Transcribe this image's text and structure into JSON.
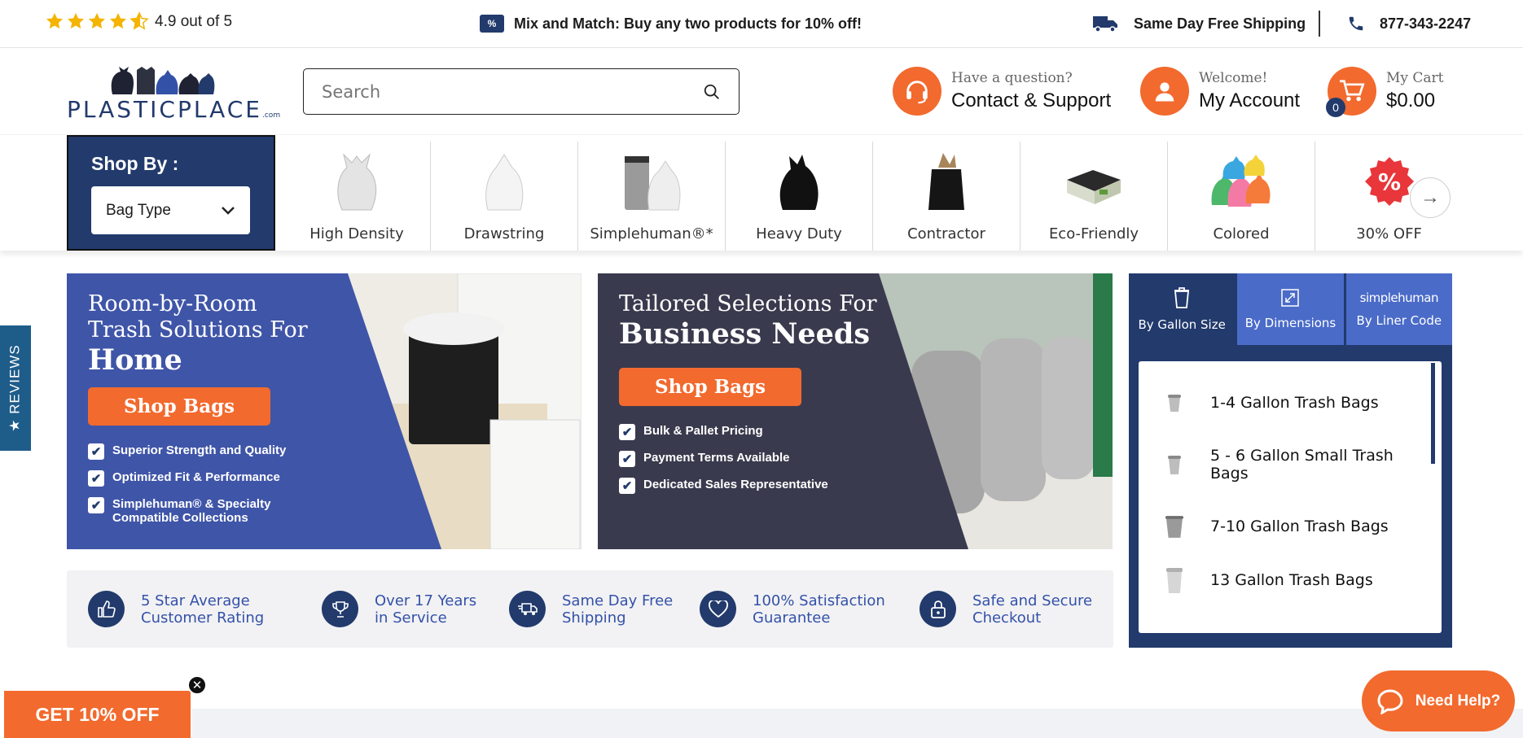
{
  "topbar": {
    "rating_text": "4.9 out of 5",
    "stars": 4.5,
    "promo_icon": "%",
    "promo_text": "Mix and Match: Buy any two products for 10% off!",
    "shipping_text": "Same Day Free Shipping",
    "phone": "877-343-2247"
  },
  "header": {
    "logo_text": "PLASTICPLACE",
    "logo_suffix": ".com",
    "search_placeholder": "Search",
    "support_small": "Have a question?",
    "support_big": "Contact & Support",
    "account_small": "Welcome!",
    "account_big": "My Account",
    "cart_small": "My Cart",
    "cart_big": "$0.00",
    "cart_count": "0"
  },
  "shopby": {
    "title": "Shop By :",
    "selected": "Bag Type"
  },
  "categories": [
    {
      "label": "High Density",
      "icon": "clear-bag-icon"
    },
    {
      "label": "Drawstring",
      "icon": "white-drawstring-bag-icon"
    },
    {
      "label": "Simplehuman®*",
      "icon": "can-liner-icon"
    },
    {
      "label": "Heavy Duty",
      "icon": "black-bag-icon"
    },
    {
      "label": "Contractor",
      "icon": "contractor-bag-icon"
    },
    {
      "label": "Eco-Friendly",
      "icon": "eco-box-icon"
    },
    {
      "label": "Colored",
      "icon": "colored-bags-icon"
    },
    {
      "label": "30% OFF",
      "icon": "discount-badge-icon"
    }
  ],
  "banner_home": {
    "pre": "Room-by-Room Trash Solutions For",
    "big": "Home",
    "button": "Shop Bags",
    "bullets": [
      "Superior Strength and Quality",
      "Optimized Fit & Performance",
      "Simplehuman® & Specialty Compatible Collections"
    ]
  },
  "banner_business": {
    "pre": "Tailored Selections For",
    "big": "Business Needs",
    "button": "Shop Bags",
    "bullets": [
      "Bulk & Pallet Pricing",
      "Payment Terms Available",
      "Dedicated Sales Representative"
    ]
  },
  "finder": {
    "tabs": [
      {
        "label": "By Gallon Size",
        "icon": "trash-can-icon"
      },
      {
        "label": "By Dimensions",
        "icon": "expand-icon"
      },
      {
        "label": "By Liner Code",
        "icon": "simplehuman-logo",
        "logo_text": "simplehuman"
      }
    ],
    "items": [
      "1-4 Gallon Trash Bags",
      "5 - 6 Gallon Small Trash Bags",
      "7-10 Gallon Trash Bags",
      "13 Gallon Trash Bags"
    ]
  },
  "features": [
    {
      "line1": "5 Star Average",
      "line2": "Customer Rating",
      "icon": "thumbs-up-icon"
    },
    {
      "line1": "Over 17 Years",
      "line2": "in Service",
      "icon": "trophy-icon"
    },
    {
      "line1": "Same Day Free",
      "line2": "Shipping",
      "icon": "fast-shipping-icon"
    },
    {
      "line1": "100% Satisfaction",
      "line2": "Guarantee",
      "icon": "heart-icon"
    },
    {
      "line1": "Safe and Secure",
      "line2": "Checkout",
      "icon": "lock-icon"
    }
  ],
  "widgets": {
    "reviews_tab": "★ REVIEWS",
    "discount": "GET 10% OFF",
    "help": "Need Help?"
  },
  "colors": {
    "navy": "#223a6c",
    "orange": "#f26a2e",
    "blue_banner": "#3f55a8",
    "dark_banner": "#3a3a4e"
  }
}
